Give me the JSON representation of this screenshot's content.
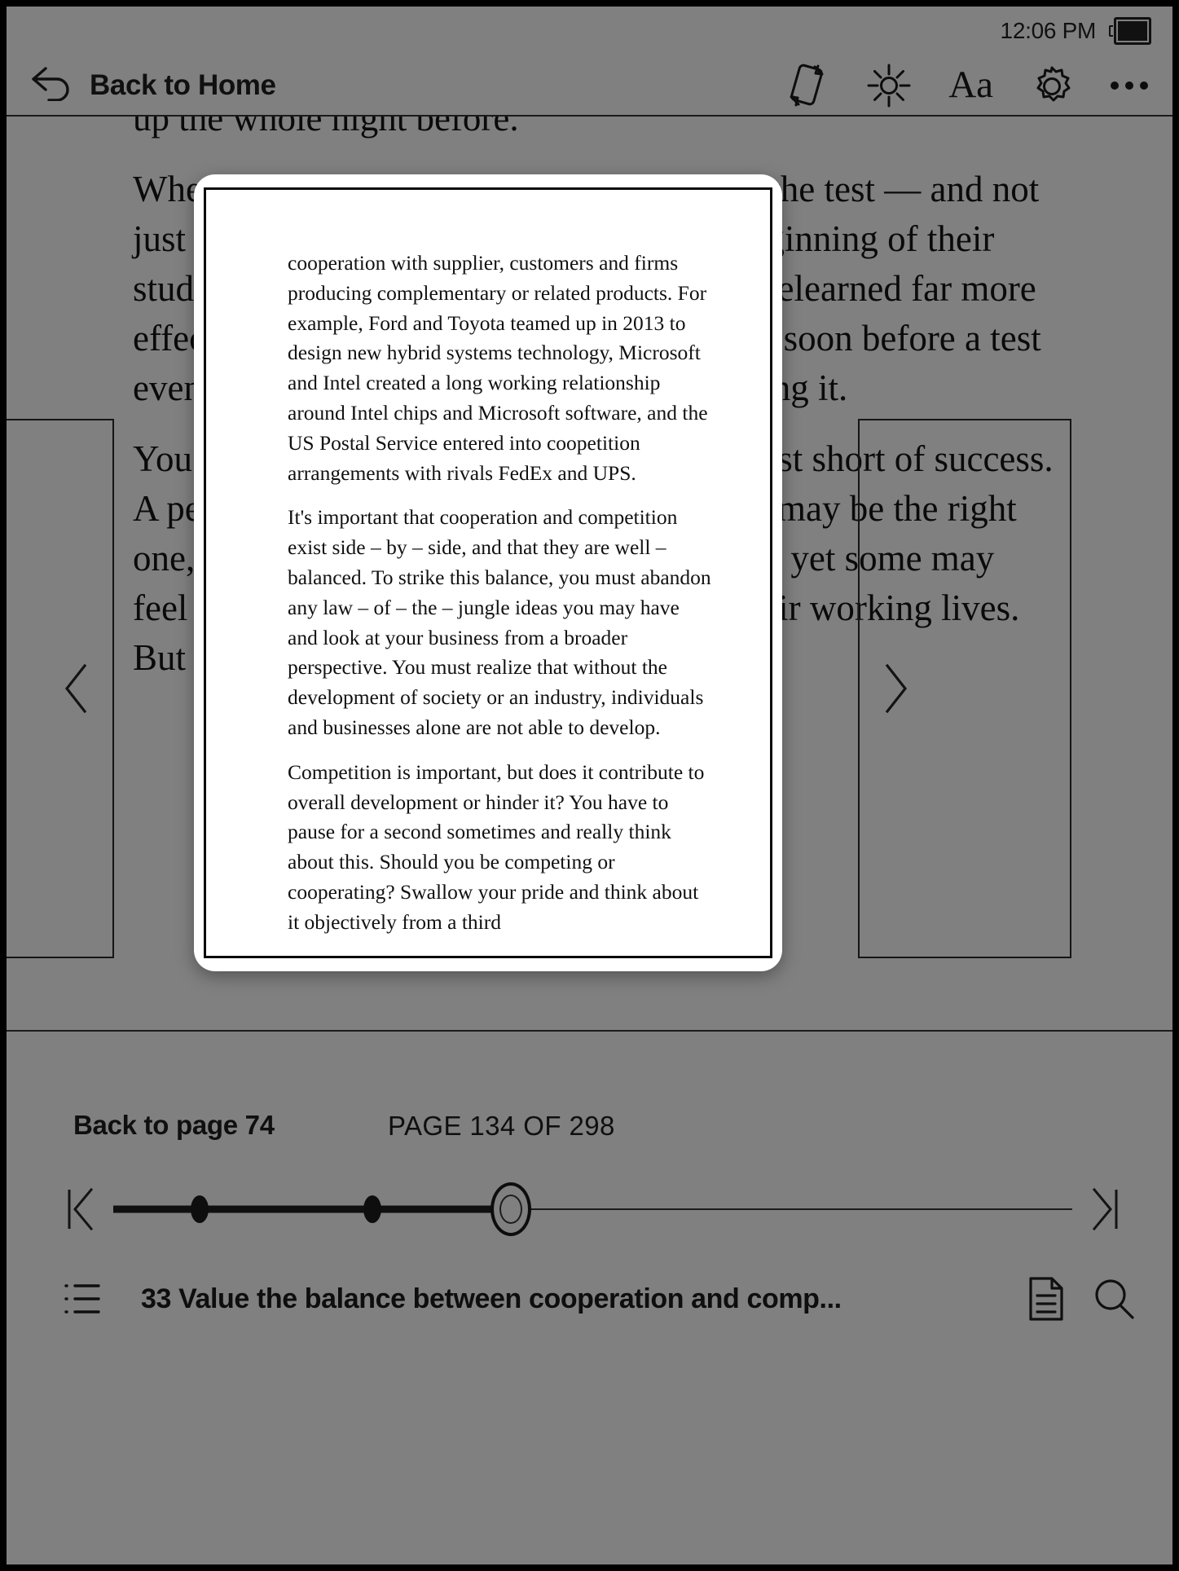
{
  "status": {
    "time": "12:06 PM",
    "battery_icon": "battery-icon"
  },
  "toolbar": {
    "back_label": "Back to Home",
    "back_icon": "back-arrow-icon",
    "icons": [
      {
        "name": "screen-rotation-icon",
        "label": "Rotate"
      },
      {
        "name": "brightness-icon",
        "label": "Brightness"
      },
      {
        "name": "font-size-icon",
        "label": "Aa"
      },
      {
        "name": "settings-gear-icon",
        "label": "Settings"
      },
      {
        "name": "more-options-icon",
        "label": "More"
      }
    ],
    "aa_label": "Aa"
  },
  "page": {
    "paragraphs": [
      "up the whole night before.",
      "When they got to school they crammed for the test — and not just when they got up, but from the very beginning of their study sessions. What they had learned was relearned far more effectively. Lots of people quit studying too soon before a test even though they had a problem remembering it.",
      "You'd be surprised how many people quit just short of success. A person may stay on a path, and their path may be the right one, and things may be going well for them; yet some may feel that the path never led them at all in their working lives. But the reason it"
    ]
  },
  "nav": {
    "prev_label": "Previous page",
    "prev_icon": "chevron-left-icon",
    "next_label": "Next page",
    "next_icon": "chevron-right-icon"
  },
  "popup": {
    "paragraphs": [
      "cooperation with supplier, customers and firms producing complementary or related products. For example, Ford and Toyota teamed up in 2013 to design new hybrid systems technology, Microsoft and Intel created a long working relationship around Intel chips and Microsoft software, and the US Postal Service entered into coopetition arrangements with rivals FedEx and UPS.",
      "It's important that cooperation and competition exist side – by – side, and that they are well – balanced. To strike this balance, you must abandon any law – of – the – jungle ideas you may have and look at your business from a broader perspective. You must realize that without the development of society or an industry, individuals and businesses alone are not able to develop.",
      "Competition is important, but does it contribute to overall development or hinder it? You have to pause for a second sometimes and really think about this. Should you be competing or cooperating? Swallow your pride and think about it objectively from a third"
    ]
  },
  "footer": {
    "back_to_page": "Back to page 74",
    "page_indicator": "PAGE 134 OF 298",
    "chapter_title": "33 Value the balance between cooperation and comp...",
    "toc_icon": "table-of-contents-icon",
    "notes_icon": "notes-document-icon",
    "search_icon": "search-icon",
    "skip_start_icon": "skip-to-start-icon",
    "skip_end_icon": "skip-to-end-icon",
    "slider_progress_percent": 41.5,
    "bookmarks_percent": [
      9,
      27
    ]
  },
  "colors": {
    "screen_bg": "#808080",
    "ink": "#101010",
    "popup_bg": "#ffffff",
    "bezel": "#000000"
  }
}
